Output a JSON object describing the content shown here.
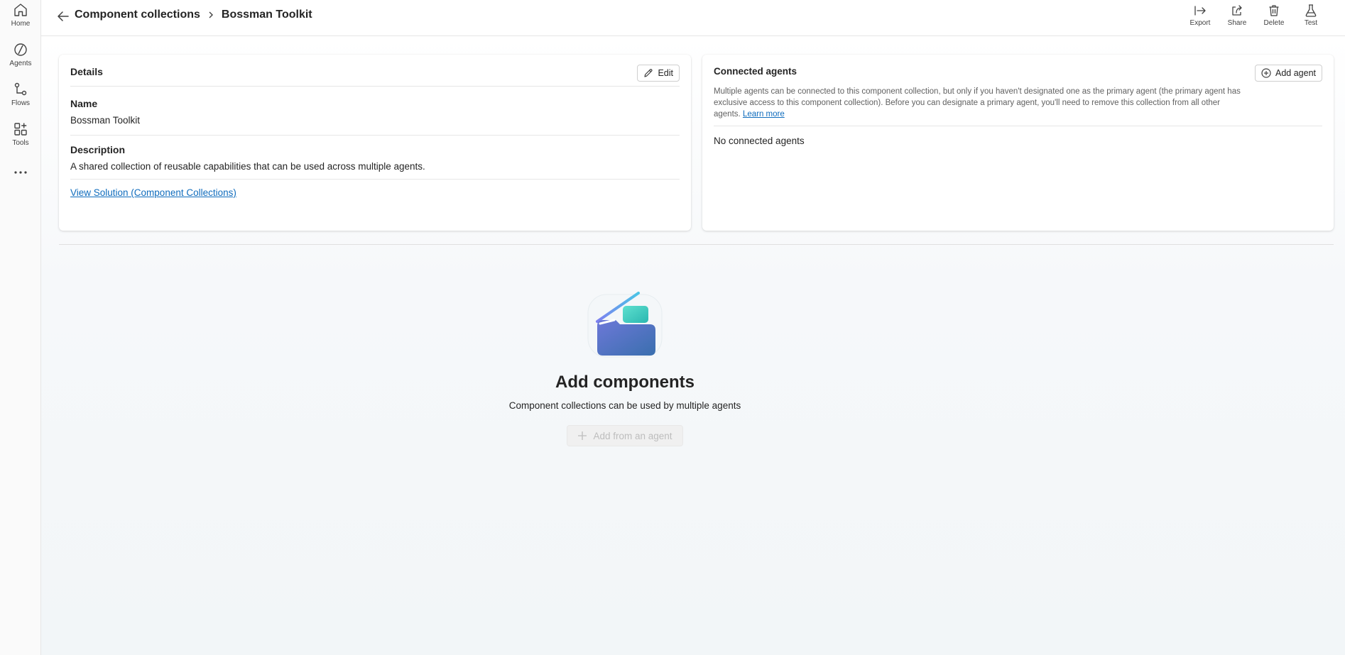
{
  "rail": {
    "items": [
      {
        "label": "Home",
        "icon": "home-icon"
      },
      {
        "label": "Agents",
        "icon": "agents-icon"
      },
      {
        "label": "Flows",
        "icon": "flows-icon"
      },
      {
        "label": "Tools",
        "icon": "tools-icon"
      }
    ],
    "more_icon": "more-icon"
  },
  "header": {
    "breadcrumb": [
      "Component collections",
      "Bossman Toolkit"
    ],
    "actions": [
      {
        "label": "Export",
        "icon": "export-icon"
      },
      {
        "label": "Share",
        "icon": "share-icon"
      },
      {
        "label": "Delete",
        "icon": "delete-icon"
      },
      {
        "label": "Test",
        "icon": "test-flask-icon"
      }
    ]
  },
  "details": {
    "title": "Details",
    "edit_label": "Edit",
    "name_label": "Name",
    "name_value": "Bossman Toolkit",
    "description_label": "Description",
    "description_value": "A shared collection of reusable capabilities that can be used across multiple agents.",
    "solution_link": "View Solution (Component Collections)"
  },
  "connected_agents": {
    "title": "Connected agents",
    "add_label": "Add agent",
    "description": "Multiple agents can be connected to this component collection, but only if you haven't designated one as the primary agent (the primary agent has exclusive access to this component collection). Before you can designate a primary agent, you'll need to remove this collection from all other agents.",
    "learn_more": "Learn more",
    "empty_text": "No connected agents"
  },
  "components": {
    "title": "Add components",
    "subtitle": "Component collections can be used by multiple agents",
    "button_label": "Add from an agent"
  },
  "colors": {
    "link": "#0f6cbd",
    "text": "#242424",
    "muted": "#616161",
    "disabled": "#bdbdbd"
  }
}
